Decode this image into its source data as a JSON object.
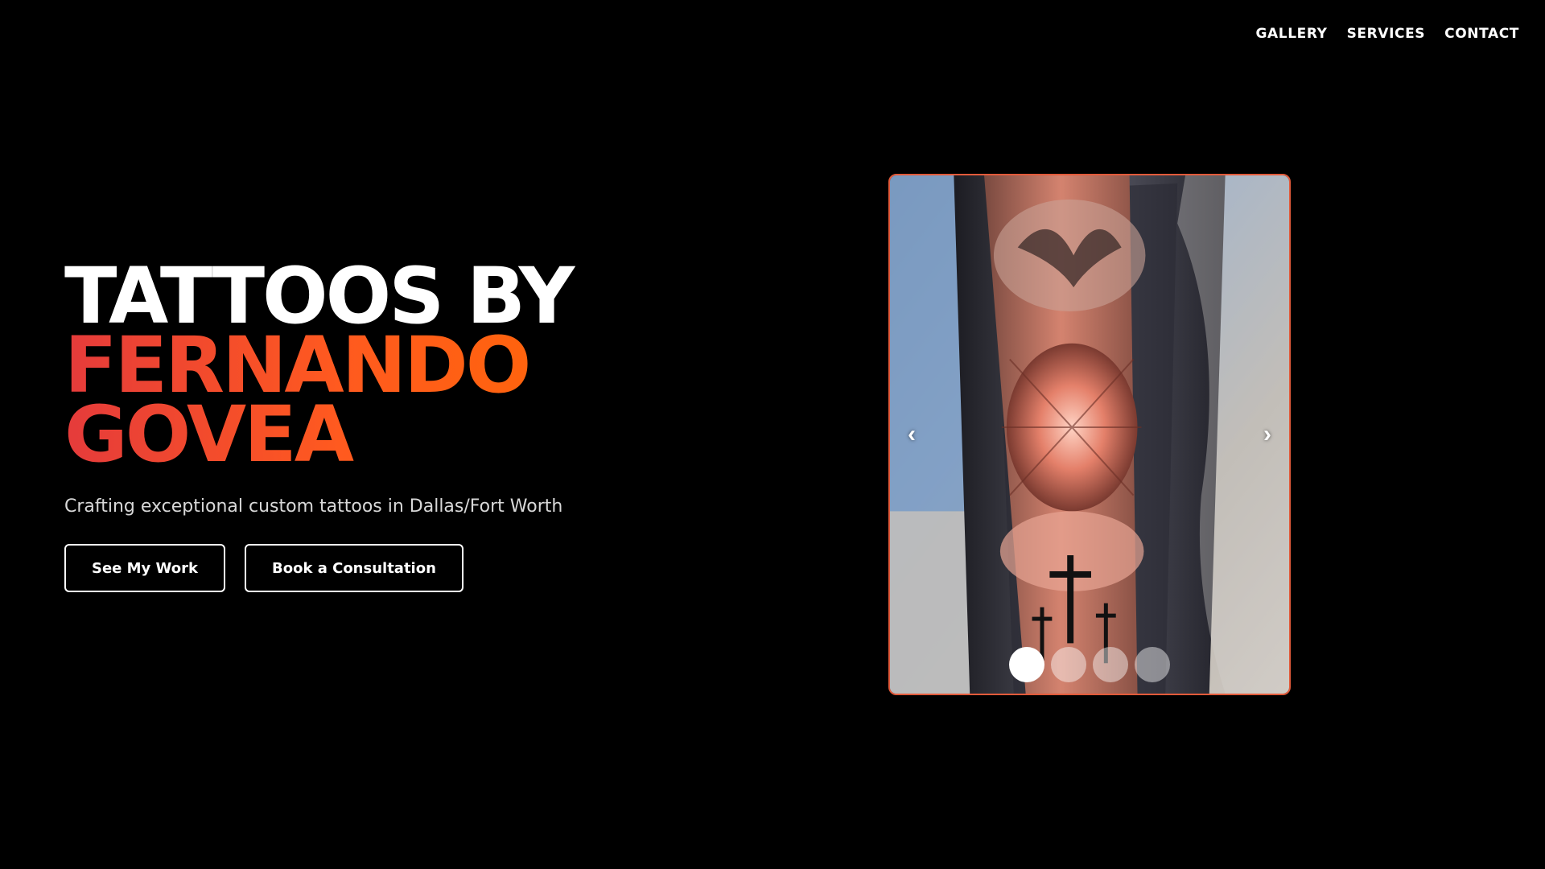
{
  "nav": {
    "items": [
      "GALLERY",
      "SERVICES",
      "CONTACT"
    ]
  },
  "hero": {
    "title_line1": "TATTOOS BY",
    "title_line2": "FERNANDO",
    "title_line3": "GOVEA",
    "subtitle": "Crafting exceptional custom tattoos in Dallas/Fort Worth",
    "primary_button": "See My Work",
    "secondary_button": "Book a Consultation"
  },
  "carousel": {
    "prev_label": "‹",
    "next_label": "›",
    "slide_count": 4,
    "active_index": 0,
    "image_alt": "Forearm tattoo with dove, clouds, reaching hands and crosses"
  },
  "colors": {
    "background": "#000000",
    "accent_start": "#e53b3b",
    "accent_end": "#ff6a00",
    "carousel_border": "#e25a3a"
  }
}
